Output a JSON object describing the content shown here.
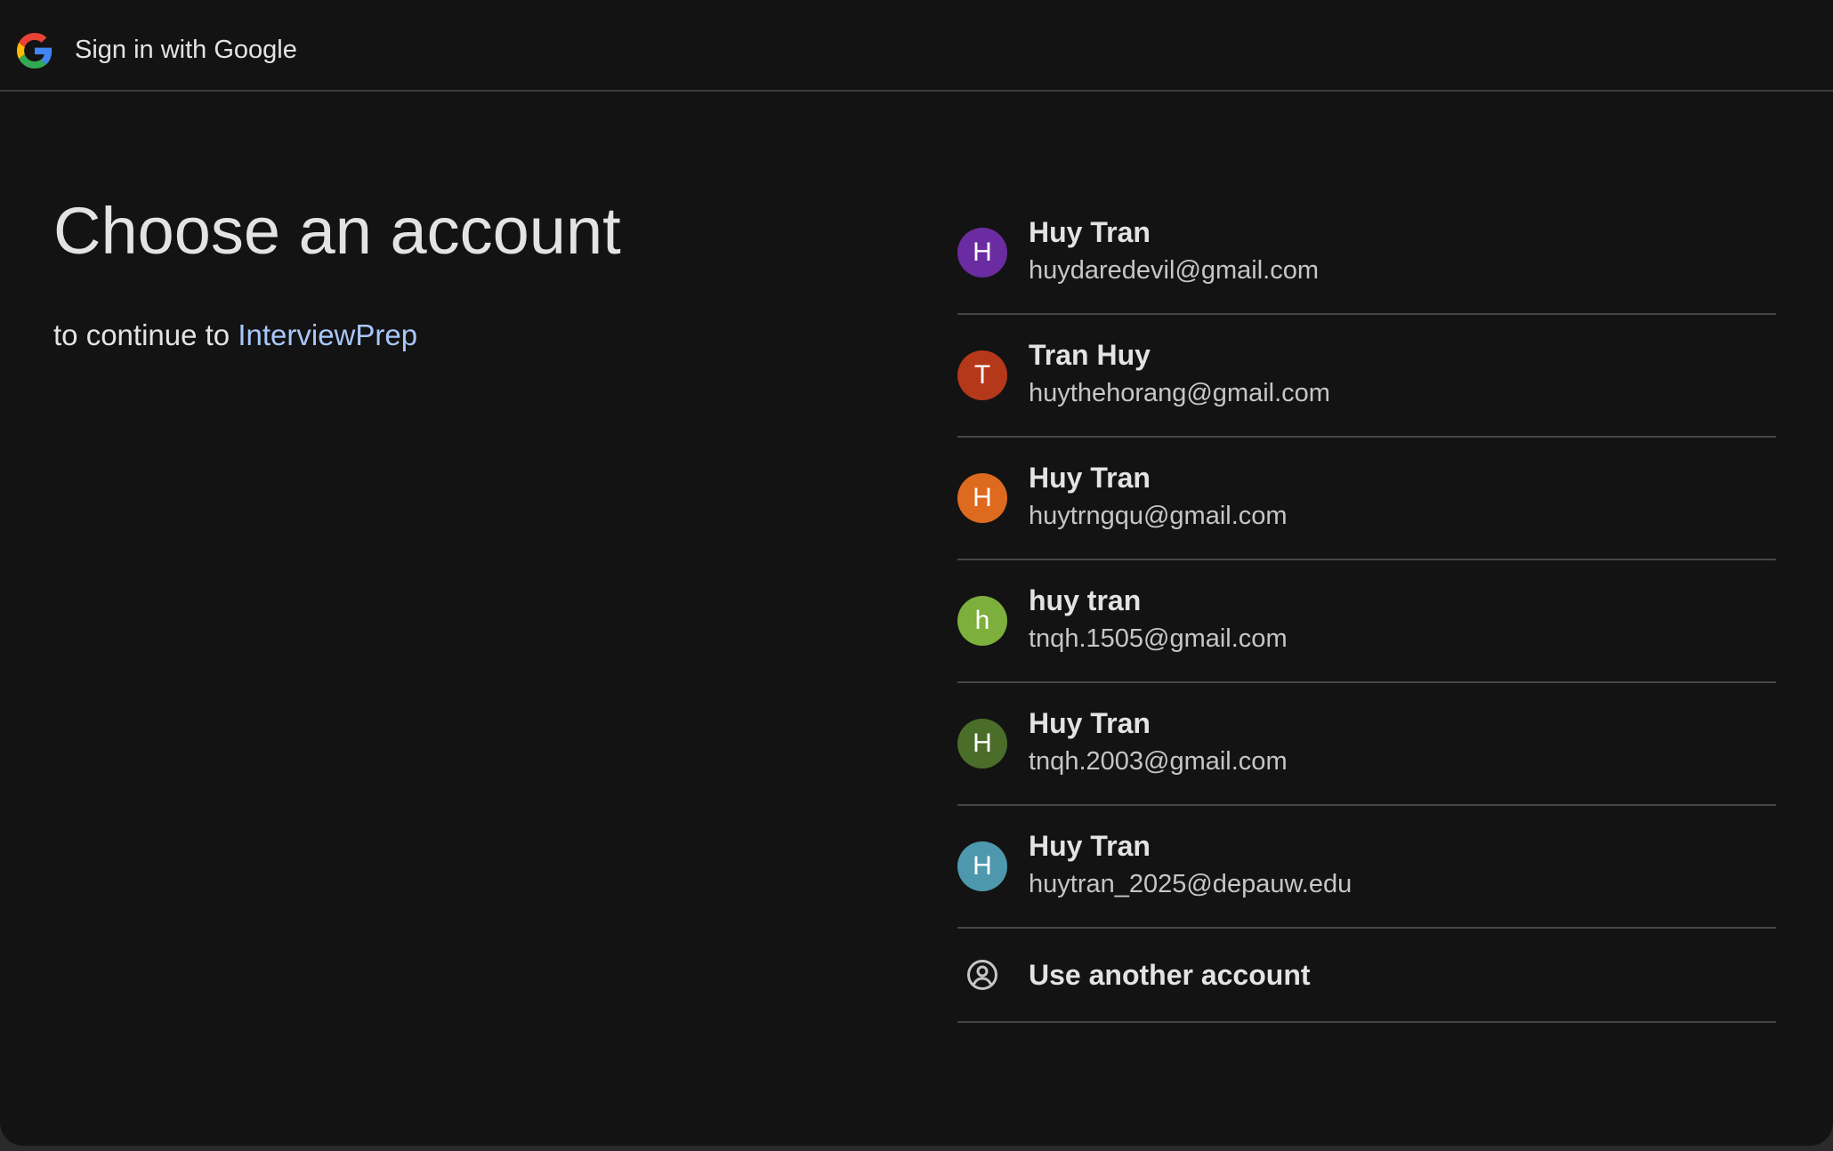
{
  "header": {
    "title": "Sign in with Google",
    "logo_icon": "google-g-icon"
  },
  "main": {
    "title": "Choose an account",
    "subtitle_prefix": "to continue to ",
    "app_name": "InterviewPrep"
  },
  "accounts": [
    {
      "initial": "H",
      "name": "Huy Tran",
      "email": "huydaredevil@gmail.com",
      "color": "#6a2ca0"
    },
    {
      "initial": "T",
      "name": "Tran Huy",
      "email": "huythehorang@gmail.com",
      "color": "#b5381a"
    },
    {
      "initial": "H",
      "name": "Huy Tran",
      "email": "huytrngqu@gmail.com",
      "color": "#dd6a1f"
    },
    {
      "initial": "h",
      "name": "huy tran",
      "email": "tnqh.1505@gmail.com",
      "color": "#7caf3c"
    },
    {
      "initial": "H",
      "name": "Huy Tran",
      "email": "tnqh.2003@gmail.com",
      "color": "#4a6d2a"
    },
    {
      "initial": "H",
      "name": "Huy Tran",
      "email": "huytran_2025@depauw.edu",
      "color": "#4e98ad"
    }
  ],
  "use_another": {
    "label": "Use another account",
    "icon": "account-circle-icon"
  },
  "colors": {
    "background": "#131313",
    "text": "#e3e3e3",
    "link": "#a8c7fa",
    "divider": "#444746"
  }
}
